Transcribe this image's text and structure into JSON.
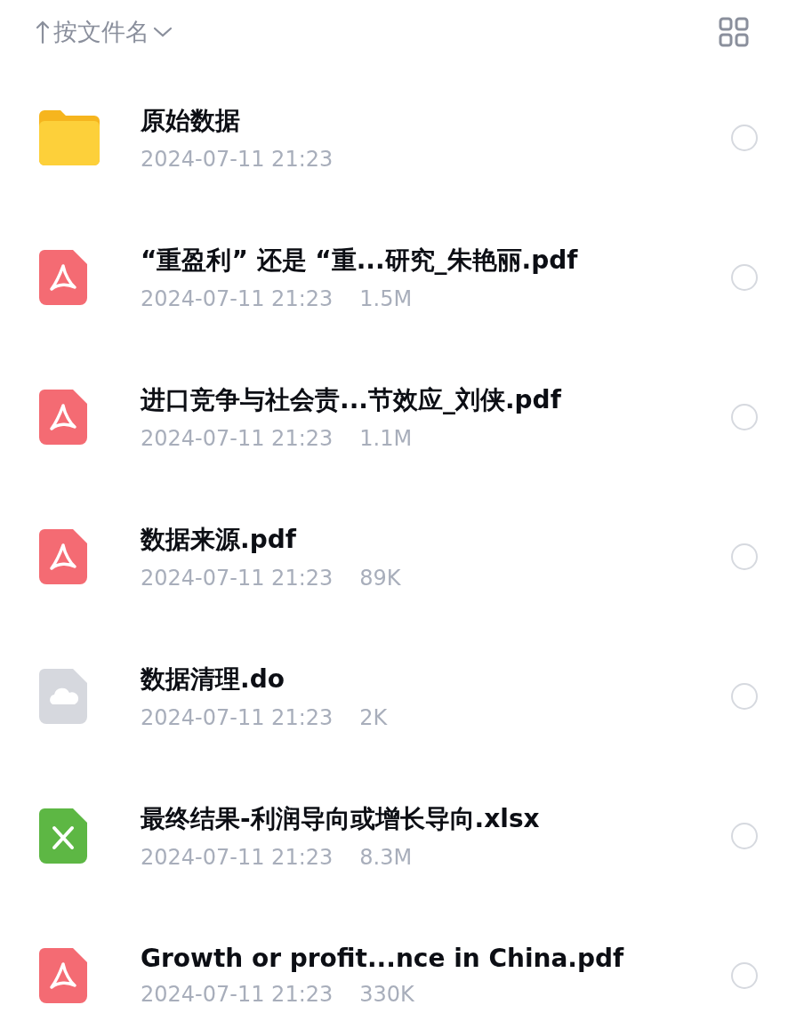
{
  "sort": {
    "label": "按文件名"
  },
  "files": [
    {
      "kind": "folder",
      "name": "原始数据",
      "date": "2024-07-11 21:23",
      "selected": false
    },
    {
      "kind": "pdf",
      "name": "“重盈利” 还是 “重...研究_朱艳丽.pdf",
      "date": "2024-07-11 21:23",
      "size": "1.5M",
      "selected": false
    },
    {
      "kind": "pdf",
      "name": "进口竞争与社会责...节效应_刘侠.pdf",
      "date": "2024-07-11 21:23",
      "size": "1.1M",
      "selected": false
    },
    {
      "kind": "pdf",
      "name": "数据来源.pdf",
      "date": "2024-07-11 21:23",
      "size": "89K",
      "selected": false
    },
    {
      "kind": "cloud",
      "name": "数据清理.do",
      "date": "2024-07-11 21:23",
      "size": "2K",
      "selected": false
    },
    {
      "kind": "xlsx",
      "name": "最终结果-利润导向或增长导向.xlsx",
      "date": "2024-07-11 21:23",
      "size": "8.3M",
      "selected": false
    },
    {
      "kind": "pdf",
      "name": "Growth or profit...nce in China.pdf",
      "date": "2024-07-11 21:23",
      "size": "330K",
      "selected": false
    }
  ]
}
